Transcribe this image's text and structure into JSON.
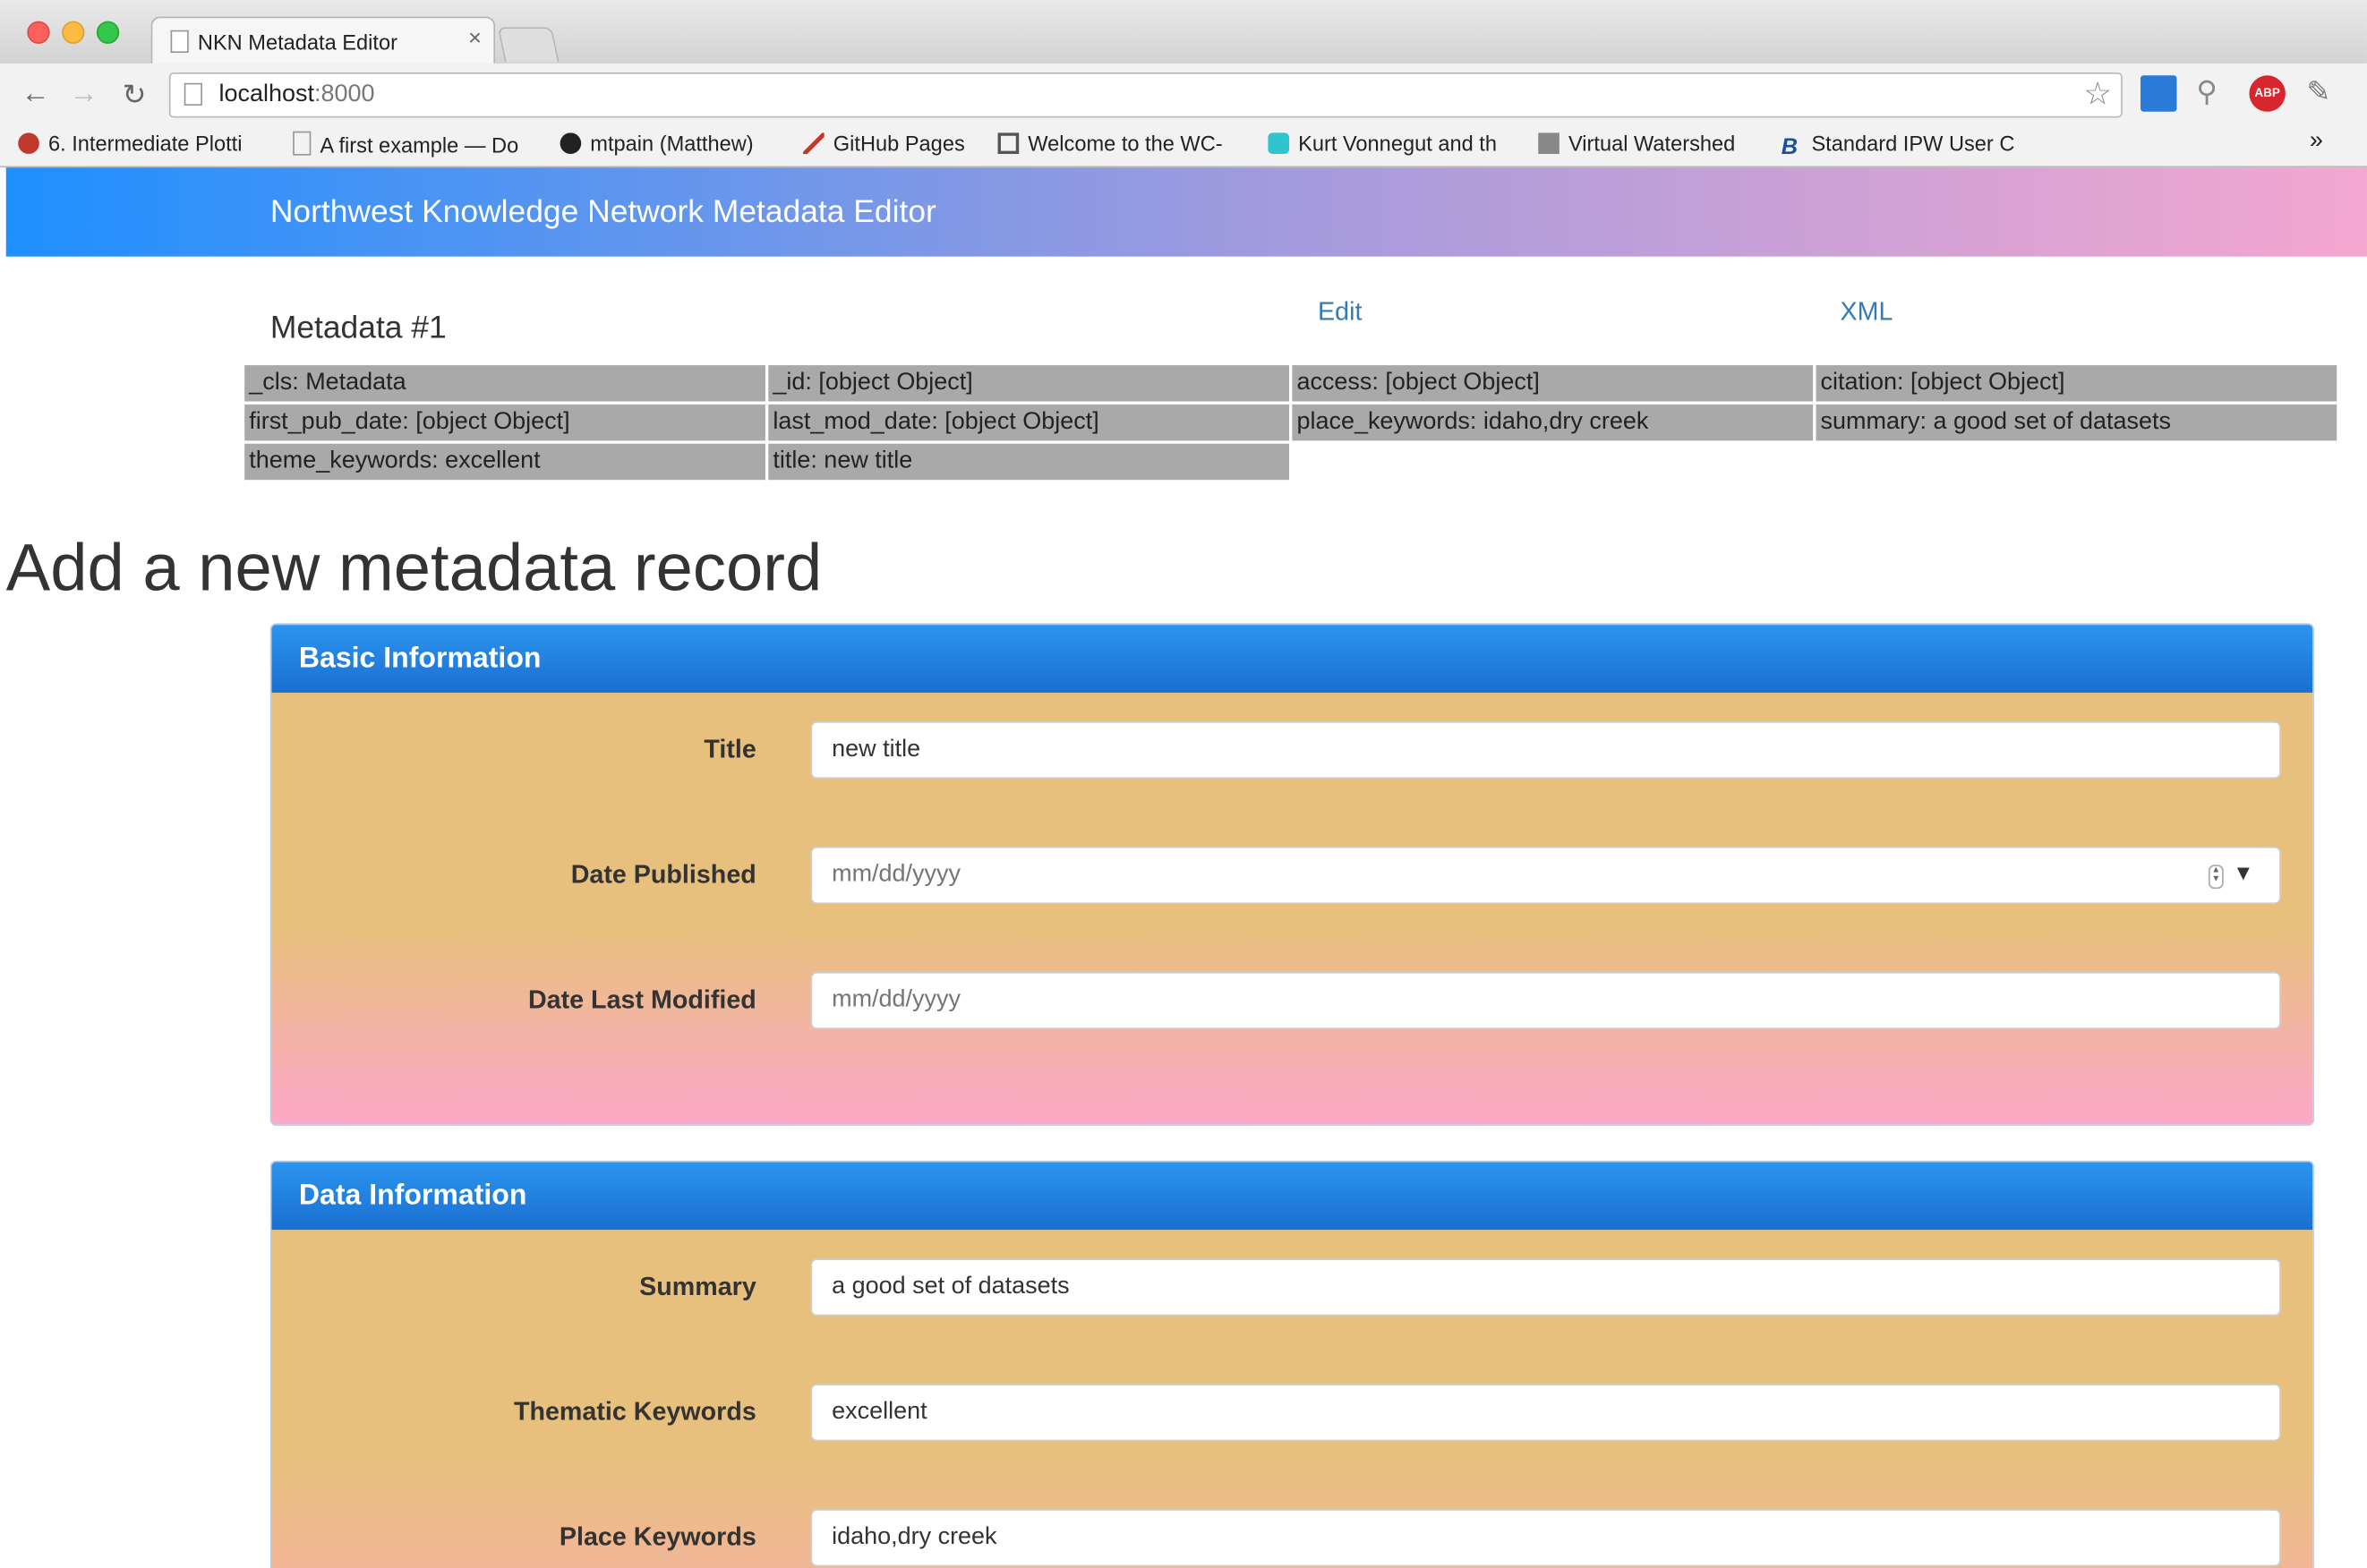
{
  "browser": {
    "tab_title": "NKN Metadata Editor",
    "tab_close": "×",
    "url_host": "localhost",
    "url_port": ":8000",
    "bookmarks": [
      "6. Intermediate Plotti",
      "A first example — Do",
      "mtpain (Matthew)",
      "GitHub Pages",
      "Welcome to the WC-",
      "Kurt Vonnegut and th",
      "Virtual Watershed",
      "Standard IPW User C"
    ],
    "bookmarks_overflow": "»",
    "abp_label": "ABP"
  },
  "navbar": {
    "brand": "Northwest Knowledge Network Metadata Editor"
  },
  "metadata": {
    "title": "Metadata #1",
    "edit_link": "Edit",
    "xml_link": "XML",
    "cells": [
      "_cls: Metadata",
      "_id: [object Object]",
      "access: [object Object]",
      "citation: [object Object]",
      "first_pub_date: [object Object]",
      "last_mod_date: [object Object]",
      "place_keywords: idaho,dry creek",
      "summary: a good set of datasets",
      "theme_keywords: excellent",
      "title: new title"
    ]
  },
  "form": {
    "heading": "Add a new metadata record",
    "basic": {
      "title": "Basic Information",
      "title_label": "Title",
      "title_value": "new title",
      "date_published_label": "Date Published",
      "date_published_placeholder": "mm/dd/yyyy",
      "date_modified_label": "Date Last Modified",
      "date_modified_placeholder": "mm/dd/yyyy"
    },
    "data": {
      "title": "Data Information",
      "summary_label": "Summary",
      "summary_value": "a good set of datasets",
      "thematic_label": "Thematic Keywords",
      "thematic_value": "excellent",
      "place_label": "Place Keywords",
      "place_value": "idaho,dry creek"
    }
  },
  "colors": {
    "navbar_gradient": [
      "#1e90ff",
      "#a59bdc",
      "#f4a7d0"
    ],
    "panel_heading": "#1b6fd0",
    "panel_body_top": "#e8c07e",
    "panel_body_bottom": "#fca8c8",
    "cell_bg": "#a9a9a9",
    "link": "#337ab7"
  }
}
